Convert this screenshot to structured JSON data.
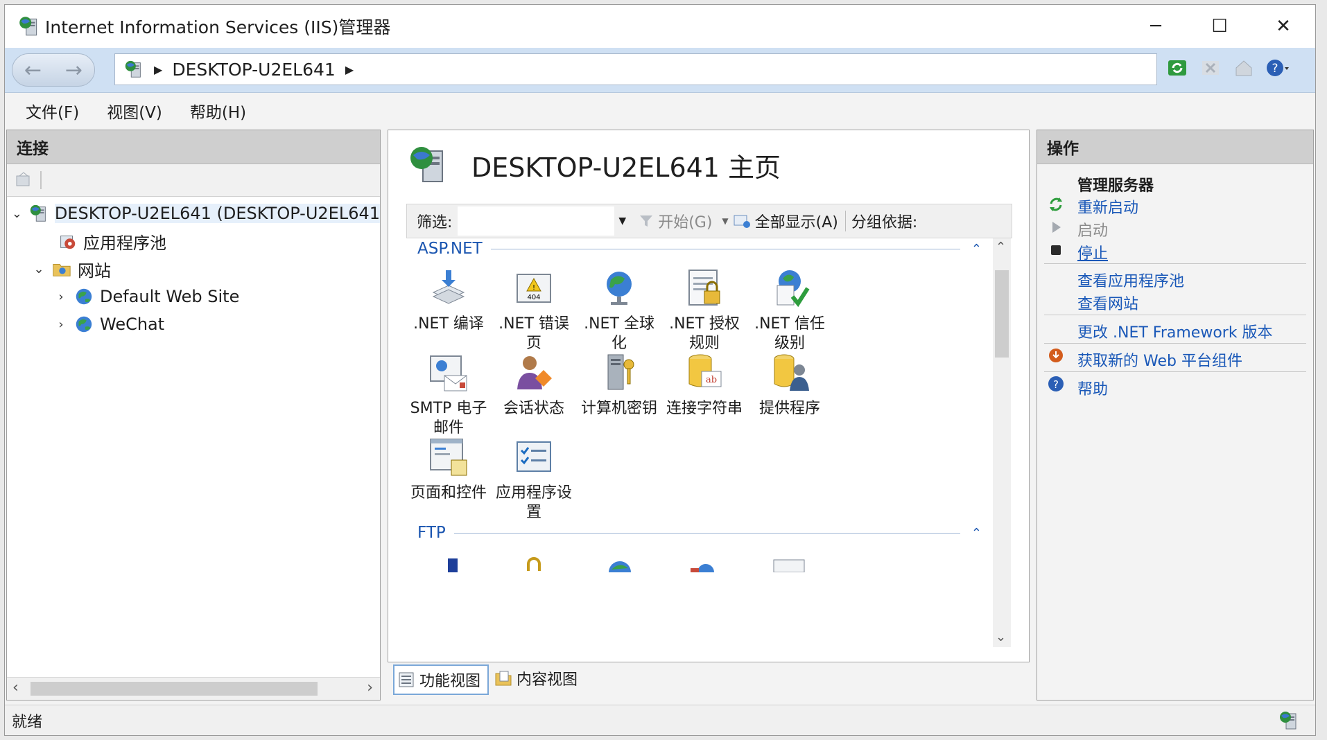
{
  "window": {
    "title": "Internet Information Services (IIS)管理器",
    "controls": {
      "minimize": "─",
      "maximize": "☐",
      "close": "✕"
    }
  },
  "navbar": {
    "breadcrumb": [
      "DESKTOP-U2EL641"
    ],
    "tools": [
      "refresh-icon",
      "stop-icon",
      "home-icon",
      "help-icon"
    ]
  },
  "menu": [
    "文件(F)",
    "视图(V)",
    "帮助(H)"
  ],
  "connections": {
    "title": "连接",
    "tree": [
      {
        "label": "DESKTOP-U2EL641 (DESKTOP-U2EL641",
        "level": 0,
        "expanded": true,
        "selected": true,
        "icon": "server-icon"
      },
      {
        "label": "应用程序池",
        "level": 1,
        "icon": "app-pool-icon"
      },
      {
        "label": "网站",
        "level": 1,
        "expanded": true,
        "icon": "sites-folder-icon"
      },
      {
        "label": "Default Web Site",
        "level": 2,
        "expanded": false,
        "icon": "globe-icon"
      },
      {
        "label": "WeChat",
        "level": 2,
        "expanded": false,
        "icon": "globe-icon"
      }
    ]
  },
  "center": {
    "title": "DESKTOP-U2EL641 主页",
    "filter": {
      "label": "筛选:",
      "value": "",
      "start": "开始(G)",
      "show_all": "全部显示(A)",
      "group_by": "分组依据:"
    },
    "groups": [
      {
        "name": "ASP.NET",
        "features": [
          {
            "label": ".NET 编译",
            "icon": "net-compile-icon"
          },
          {
            "label": ".NET 错误页",
            "icon": "net-error-pages-icon"
          },
          {
            "label": ".NET 全球化",
            "icon": "net-globalization-icon"
          },
          {
            "label": ".NET 授权规则",
            "icon": "net-authorization-icon"
          },
          {
            "label": ".NET 信任级别",
            "icon": "net-trust-icon"
          },
          {
            "label": "SMTP 电子邮件",
            "icon": "smtp-icon"
          },
          {
            "label": "会话状态",
            "icon": "session-state-icon"
          },
          {
            "label": "计算机密钥",
            "icon": "machine-key-icon"
          },
          {
            "label": "连接字符串",
            "icon": "connection-strings-icon"
          },
          {
            "label": "提供程序",
            "icon": "providers-icon"
          },
          {
            "label": "页面和控件",
            "icon": "pages-controls-icon"
          },
          {
            "label": "应用程序设置",
            "icon": "app-settings-icon"
          }
        ]
      },
      {
        "name": "FTP",
        "features": []
      }
    ],
    "views": {
      "features": "功能视图",
      "content": "内容视图"
    }
  },
  "actions": {
    "title": "操作",
    "section": "管理服务器",
    "items": {
      "restart": "重新启动",
      "start": "启动",
      "stop": "停止",
      "view_pools": "查看应用程序池",
      "view_sites": "查看网站",
      "change_net": "更改 .NET Framework 版本",
      "get_web": "获取新的 Web 平台组件",
      "help": "帮助"
    }
  },
  "status": {
    "text": "就绪"
  },
  "colors": {
    "link": "#1a58b8",
    "navbar": "#cfe0f3",
    "selected": "#e6f0fb"
  }
}
